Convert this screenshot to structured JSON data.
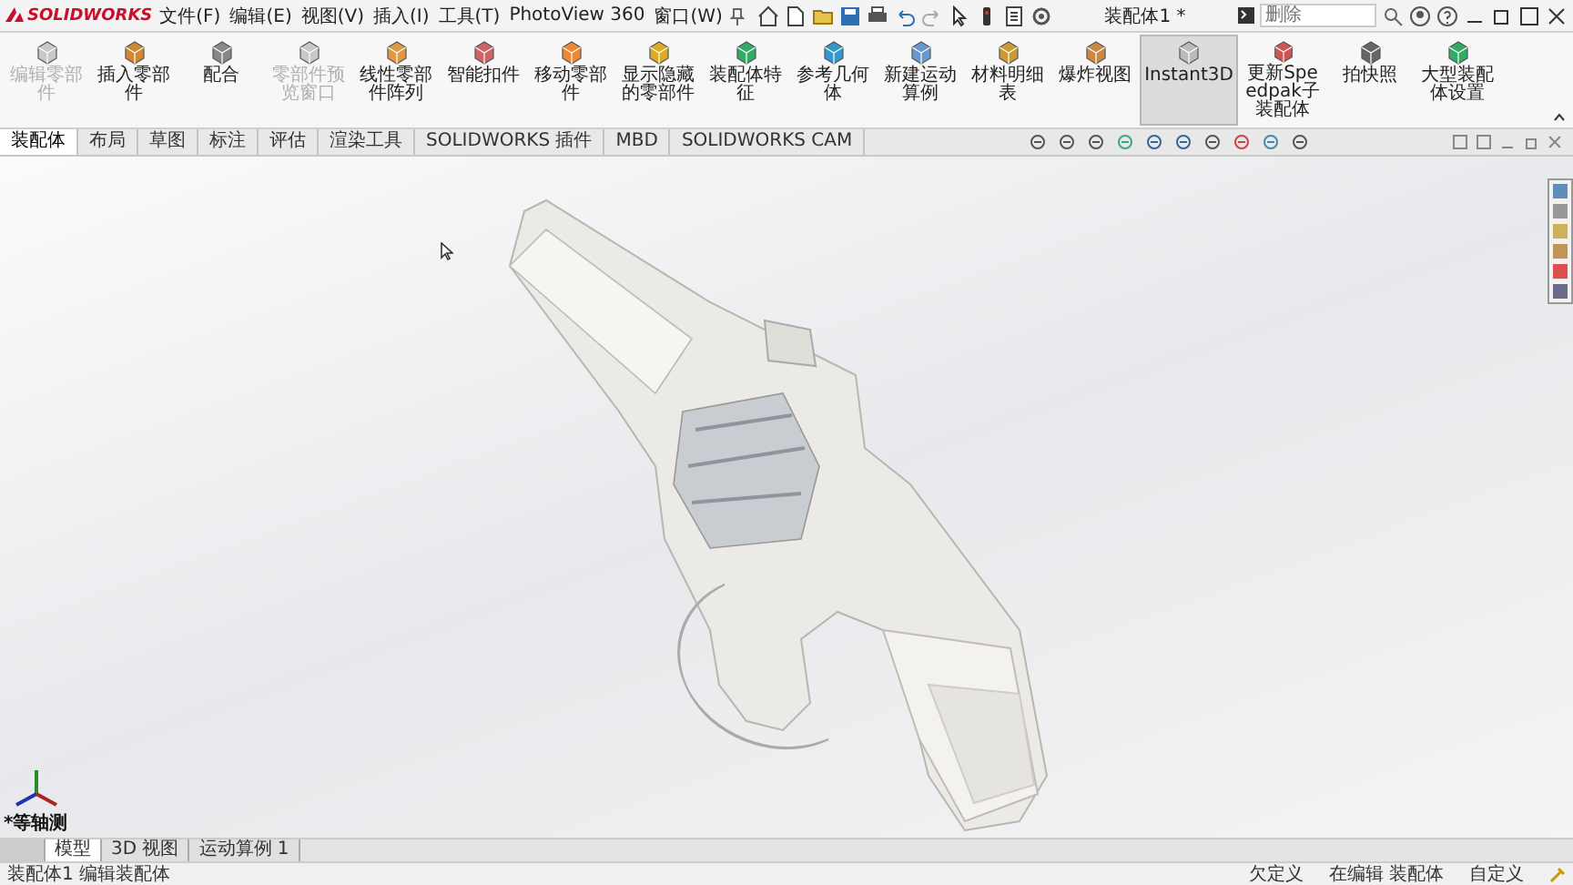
{
  "app": {
    "name": "SOLIDWORKS"
  },
  "menu": [
    "文件(F)",
    "编辑(E)",
    "视图(V)",
    "插入(I)",
    "工具(T)",
    "PhotoView 360",
    "窗口(W)"
  ],
  "title": "装配体1 *",
  "search": {
    "placeholder": "删除"
  },
  "ribbon": [
    {
      "label": "编辑零部件",
      "disabled": true,
      "selected": false
    },
    {
      "label": "插入零部件",
      "disabled": false,
      "selected": false
    },
    {
      "label": "配合",
      "disabled": false,
      "selected": false
    },
    {
      "label": "零部件预览窗口",
      "disabled": true,
      "selected": false
    },
    {
      "label": "线性零部件阵列",
      "disabled": false,
      "selected": false
    },
    {
      "label": "智能扣件",
      "disabled": false,
      "selected": false
    },
    {
      "label": "移动零部件",
      "disabled": false,
      "selected": false
    },
    {
      "label": "显示隐藏的零部件",
      "disabled": false,
      "selected": false
    },
    {
      "label": "装配体特征",
      "disabled": false,
      "selected": false
    },
    {
      "label": "参考几何体",
      "disabled": false,
      "selected": false
    },
    {
      "label": "新建运动算例",
      "disabled": false,
      "selected": false
    },
    {
      "label": "材料明细表",
      "disabled": false,
      "selected": false
    },
    {
      "label": "爆炸视图",
      "disabled": false,
      "selected": false
    },
    {
      "label": "Instant3D",
      "disabled": false,
      "selected": true
    },
    {
      "label": "更新Speedpak子装配体",
      "disabled": false,
      "selected": false
    },
    {
      "label": "拍快照",
      "disabled": false,
      "selected": false
    },
    {
      "label": "大型装配体设置",
      "disabled": false,
      "selected": false
    }
  ],
  "tabs": [
    {
      "label": "装配体",
      "selected": true
    },
    {
      "label": "布局",
      "selected": false
    },
    {
      "label": "草图",
      "selected": false
    },
    {
      "label": "标注",
      "selected": false
    },
    {
      "label": "评估",
      "selected": false
    },
    {
      "label": "渲染工具",
      "selected": false
    },
    {
      "label": "SOLIDWORKS 插件",
      "selected": false
    },
    {
      "label": "MBD",
      "selected": false
    },
    {
      "label": "SOLIDWORKS CAM",
      "selected": false
    }
  ],
  "view": {
    "orientation": "*等轴测"
  },
  "bottom_tabs": [
    {
      "label": "模型",
      "selected": true
    },
    {
      "label": "3D 视图",
      "selected": false
    },
    {
      "label": "运动算例 1",
      "selected": false
    }
  ],
  "status_bar": {
    "left": "装配体1 编辑装配体",
    "items": [
      "欠定义",
      "在编辑 装配体",
      "自定义"
    ]
  }
}
